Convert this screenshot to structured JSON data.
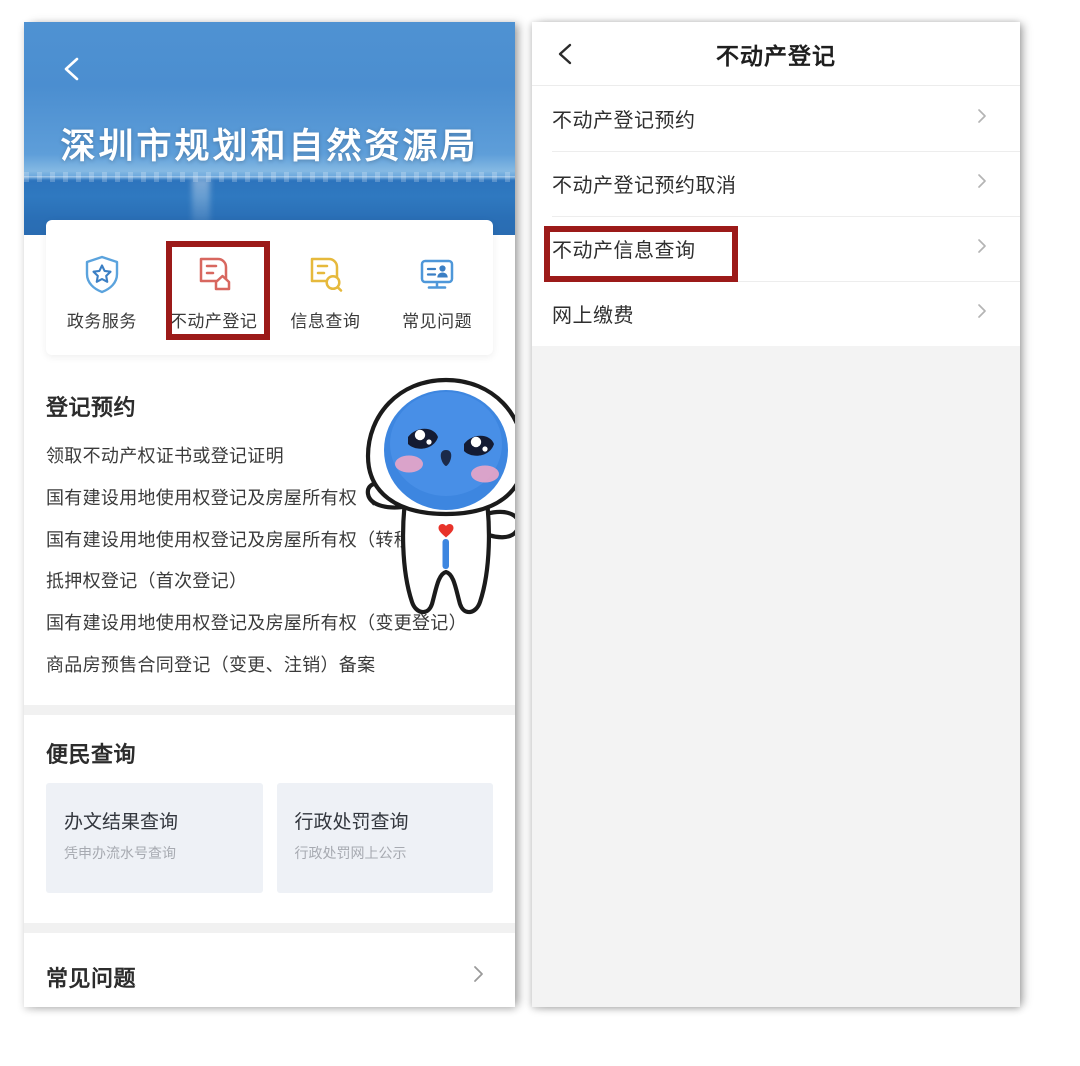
{
  "left_app": {
    "back_icon": "back-chevron-icon",
    "header_title": "深圳市规划和自然资源局",
    "quick_icons": [
      {
        "label": "政务服务",
        "icon": "shield-star-icon",
        "color": "#4e97d9"
      },
      {
        "label": "不动产登记",
        "icon": "document-house-icon",
        "color": "#d8675f"
      },
      {
        "label": "信息查询",
        "icon": "document-search-icon",
        "color": "#e6b93c"
      },
      {
        "label": "常见问题",
        "icon": "monitor-person-icon",
        "color": "#4e97d9"
      }
    ],
    "registration_section": {
      "title": "登记预约",
      "items": [
        "领取不动产权证书或登记证明",
        "国有建设用地使用权登记及房屋所有权（首次登记）",
        "国有建设用地使用权登记及房屋所有权（转移登记）",
        "抵押权登记（首次登记）",
        "国有建设用地使用权登记及房屋所有权（变更登记）",
        "商品房预售合同登记（变更、注销）备案"
      ]
    },
    "convenience_section": {
      "title": "便民查询",
      "cards": [
        {
          "title": "办文结果查询",
          "subtitle": "凭申办流水号查询"
        },
        {
          "title": "行政处罚查询",
          "subtitle": "行政处罚网上公示"
        }
      ]
    },
    "faq_row": {
      "label": "常见问题",
      "chevron": "chevron-right-icon"
    },
    "mascot": "astronaut-mascot"
  },
  "right_app": {
    "back_icon": "back-chevron-icon",
    "title": "不动产登记",
    "rows": [
      {
        "label": "不动产登记预约",
        "chevron": "chevron-right-icon"
      },
      {
        "label": "不动产登记预约取消",
        "chevron": "chevron-right-icon"
      },
      {
        "label": "不动产信息查询",
        "chevron": "chevron-right-icon"
      },
      {
        "label": "网上缴费",
        "chevron": "chevron-right-icon"
      }
    ]
  },
  "annotations": {
    "highlight_color": "#9c1a19",
    "left_highlight_target": "不动产登记",
    "right_highlight_target": "不动产信息查询"
  }
}
